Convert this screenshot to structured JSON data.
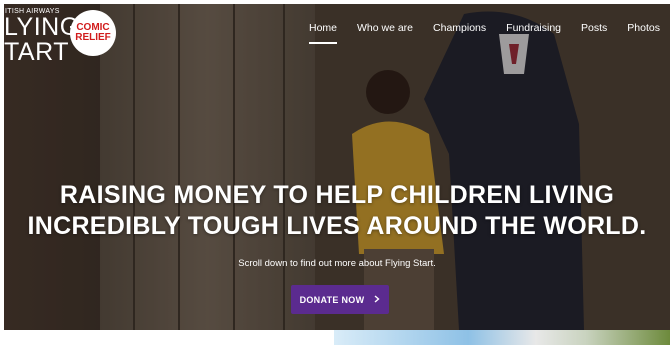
{
  "logo": {
    "ba_small": "ITISH AIRWAYS",
    "ba_line1": "LYING",
    "ba_line2": "TART",
    "cr_line1": "COMIC",
    "cr_line2": "RELIEF"
  },
  "nav": {
    "items": [
      "Home",
      "Who we are",
      "Champions",
      "Fundraising",
      "Posts",
      "Photos"
    ]
  },
  "hero": {
    "headline_line1": "RAISING MONEY TO HELP CHILDREN LIVING",
    "headline_line2": "INCREDIBLY TOUGH LIVES AROUND THE WORLD.",
    "subline": "Scroll down to find out more about Flying Start.",
    "donate_label": "DONATE NOW",
    "donate_icon": "chevron-right-icon"
  },
  "colors": {
    "accent": "#5b2b8f",
    "brand_red": "#d11c1c"
  }
}
